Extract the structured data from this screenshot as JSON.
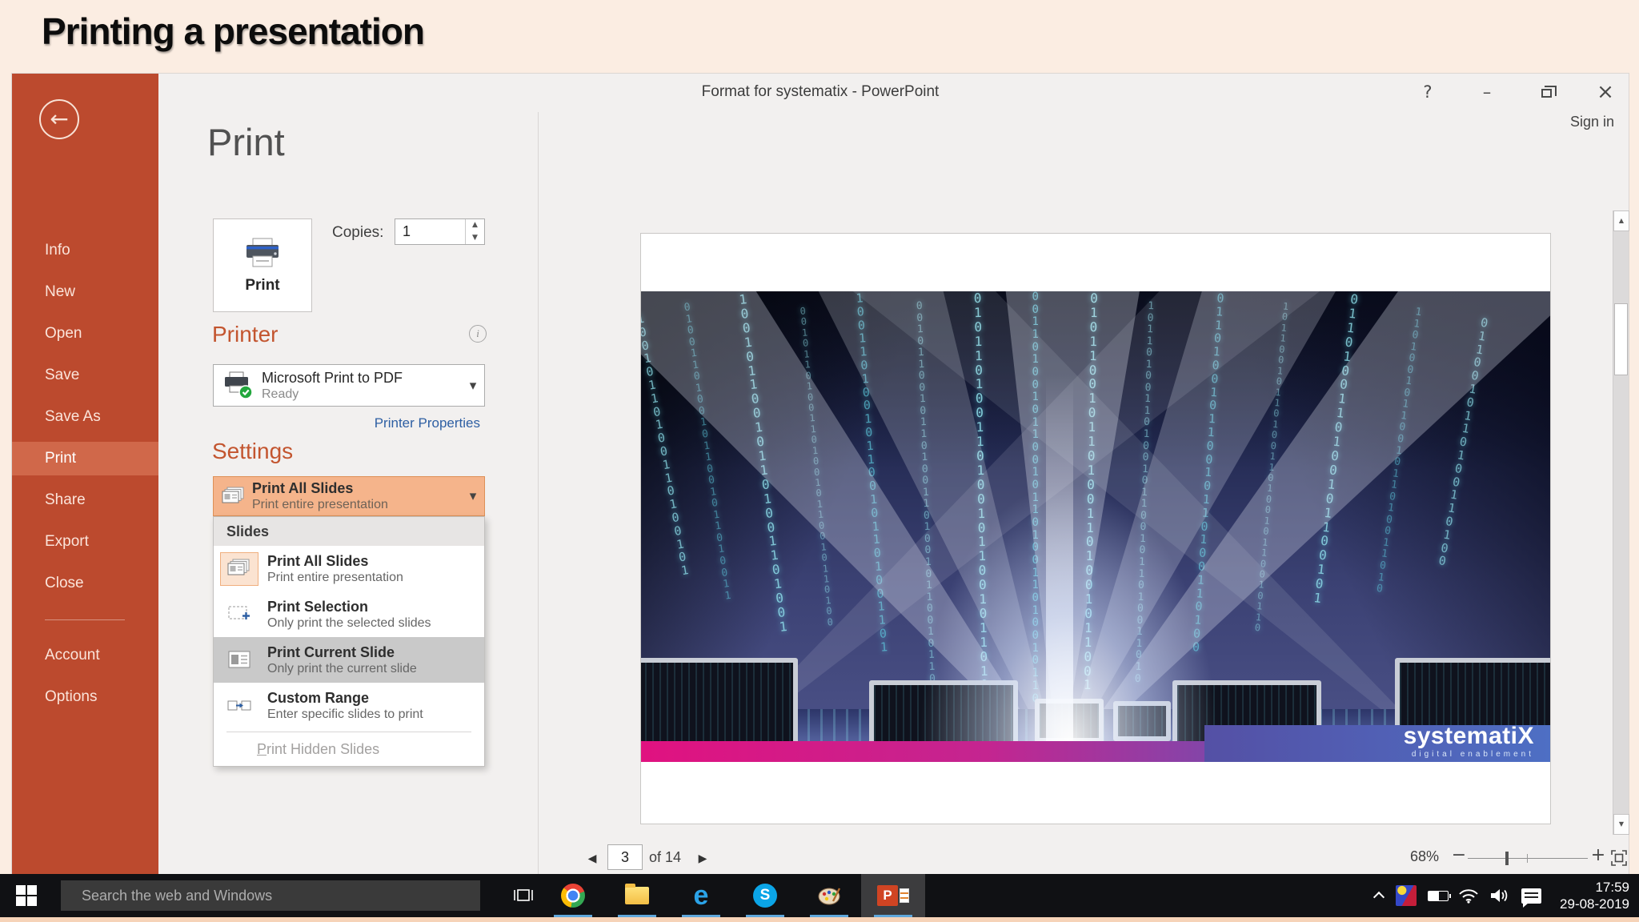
{
  "page": {
    "title": "Printing a presentation"
  },
  "window": {
    "title": "Format for systematix - PowerPoint",
    "sign_in": "Sign in"
  },
  "icons": {
    "help": "?",
    "minimize": "–",
    "close": "×",
    "back": "←",
    "caret": "▾",
    "spin_up": "▲",
    "spin_down": "▼",
    "info": "i",
    "nav_prev": "◀",
    "nav_next": "▶",
    "zoom_out": "−",
    "zoom_in": "+",
    "scroll_up": "▲",
    "scroll_down": "▼"
  },
  "sidebar": {
    "items": [
      {
        "label": "Info"
      },
      {
        "label": "New"
      },
      {
        "label": "Open"
      },
      {
        "label": "Save"
      },
      {
        "label": "Save As"
      },
      {
        "label": "Print"
      },
      {
        "label": "Share"
      },
      {
        "label": "Export"
      },
      {
        "label": "Close"
      }
    ],
    "active_item": "Print",
    "footer_items": [
      {
        "label": "Account"
      },
      {
        "label": "Options"
      }
    ]
  },
  "print": {
    "heading": "Print",
    "print_button_label": "Print",
    "copies_label": "Copies:",
    "copies_value": "1",
    "printer": {
      "heading": "Printer",
      "name": "Microsoft Print to PDF",
      "status": "Ready",
      "properties_link": "Printer Properties"
    },
    "settings": {
      "heading": "Settings",
      "selected": {
        "title": "Print All Slides",
        "subtitle": "Print entire presentation"
      },
      "menu": {
        "group_label": "Slides",
        "items": [
          {
            "title": "Print All Slides",
            "subtitle": "Print entire presentation",
            "state": "selected"
          },
          {
            "title": "Print Selection",
            "subtitle": "Only print the selected slides",
            "state": "normal"
          },
          {
            "title": "Print Current Slide",
            "subtitle": "Only print the current slide",
            "state": "hover"
          },
          {
            "title": "Custom Range",
            "subtitle": "Enter specific slides to print",
            "state": "normal"
          }
        ],
        "footer_first": "P",
        "footer_rest": "rint Hidden Slides"
      }
    }
  },
  "preview": {
    "slide_image": {
      "binary_pattern": "1 0 0 1 0 1 1 0 1 0 0 1 1 0 1 0 0 1 0 1",
      "logo_name": "systematiX",
      "logo_tagline": "digital enablement"
    },
    "nav": {
      "page": "3",
      "of": "of 14"
    },
    "zoom": {
      "level": "68%"
    }
  },
  "taskbar": {
    "search_placeholder": "Search the web and Windows",
    "apps": [
      {
        "name": "task-view"
      },
      {
        "name": "chrome"
      },
      {
        "name": "file-explorer"
      },
      {
        "name": "edge"
      },
      {
        "name": "skype"
      },
      {
        "name": "paint"
      },
      {
        "name": "powerpoint"
      }
    ],
    "tray": [
      {
        "name": "hidden-icons-chevron"
      },
      {
        "name": "photos-app"
      },
      {
        "name": "battery"
      },
      {
        "name": "wifi"
      },
      {
        "name": "volume"
      },
      {
        "name": "action-center"
      }
    ],
    "clock": {
      "time": "17:59",
      "date": "29-08-2019"
    }
  },
  "colors": {
    "sidebar_red": "#BC4A2E",
    "sidebar_active": "#D0684A",
    "accent_heading": "#C3552F",
    "selected_setting_bg": "#F5B48B",
    "menu_hover_gray": "#C9C9C9",
    "link_blue": "#2E5FA3",
    "stripe_magenta": "#E01280",
    "stripe_blue": "#4C6CBF",
    "taskbar_underline": "#5FA8DC"
  }
}
